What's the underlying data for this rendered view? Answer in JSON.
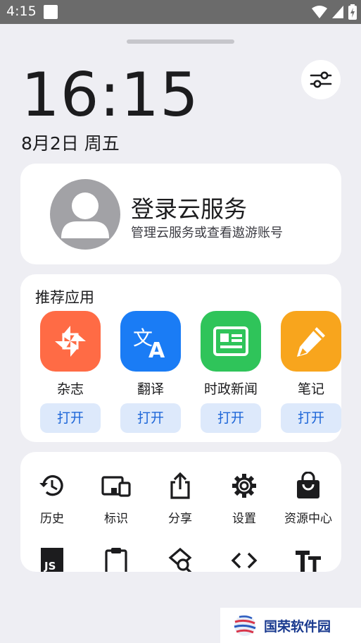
{
  "status_bar": {
    "time": "4:15"
  },
  "lock": {
    "clock": "16:15",
    "date": "8月2日 周五"
  },
  "account": {
    "title": "登录云服务",
    "subtitle": "管理云服务或查看遨游账号"
  },
  "apps": {
    "title": "推荐应用",
    "items": [
      {
        "name": "杂志",
        "open": "打开",
        "color": "#ff6b45",
        "icon": "pinwheel-icon"
      },
      {
        "name": "翻译",
        "open": "打开",
        "color": "#1a7cf5",
        "icon": "translate-icon"
      },
      {
        "name": "时政新闻",
        "open": "打开",
        "color": "#2fc45a",
        "icon": "newspaper-icon"
      },
      {
        "name": "笔记",
        "open": "打开",
        "color": "#f8a51d",
        "icon": "pencil-icon"
      }
    ]
  },
  "tools": {
    "row1": [
      {
        "label": "历史",
        "icon": "history-icon"
      },
      {
        "label": "标识",
        "icon": "devices-icon"
      },
      {
        "label": "分享",
        "icon": "share-icon"
      },
      {
        "label": "设置",
        "icon": "gear-icon"
      },
      {
        "label": "资源中心",
        "icon": "shopping-bag-icon"
      }
    ],
    "row2": [
      {
        "icon": "js-icon"
      },
      {
        "icon": "clipboard-icon"
      },
      {
        "icon": "find-in-page-icon"
      },
      {
        "icon": "code-icon"
      },
      {
        "icon": "text-size-icon"
      }
    ]
  },
  "watermark": {
    "text": "国荣软件园"
  }
}
